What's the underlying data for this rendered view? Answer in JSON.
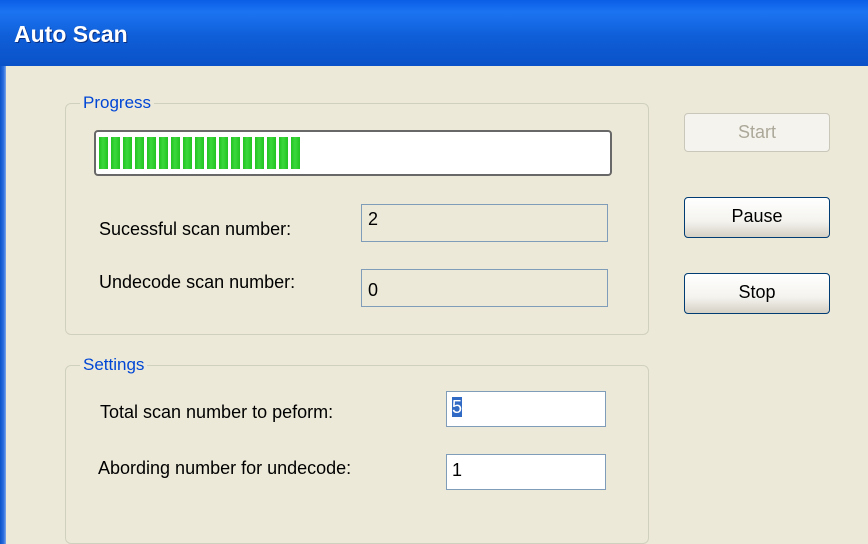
{
  "window": {
    "title": "Auto Scan"
  },
  "progress_group": {
    "legend": "Progress",
    "progress_fraction": 0.4,
    "successful_label": "Sucessful scan number:",
    "successful_value": "2",
    "undecode_label": "Undecode scan number:",
    "undecode_value": "0"
  },
  "settings_group": {
    "legend": "Settings",
    "total_label": "Total scan number to peform:",
    "total_value": "5",
    "abort_label": "Abording number for undecode:",
    "abort_value": "1"
  },
  "buttons": {
    "start": "Start",
    "pause": "Pause",
    "stop": "Stop"
  },
  "colors": {
    "titlebar": "#0A5EE6",
    "progress_fill": "#22C322",
    "group_legend": "#0046D5",
    "dialog_bg": "#ECE9D8"
  }
}
